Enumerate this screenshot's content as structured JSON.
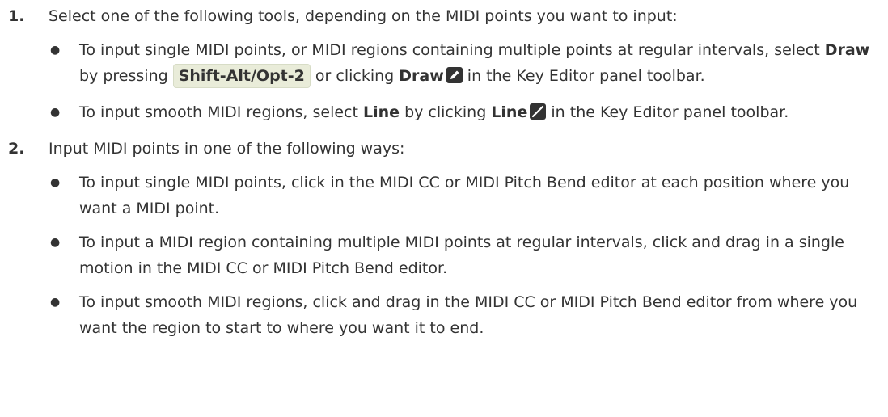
{
  "steps": [
    {
      "number": "1.",
      "text": "Select one of the following tools, depending on the MIDI points you want to input:",
      "bullets": {
        "draw": {
          "pre": "To input single MIDI points, or MIDI regions containing multiple points at regular intervals, select ",
          "tool": "Draw",
          "mid1": " by pressing ",
          "shortcut": "Shift-Alt/Opt-2",
          "mid2": " or clicking ",
          "tool2": "Draw",
          "icon": "draw-tool-icon",
          "post": " in the Key Editor panel toolbar."
        },
        "line": {
          "pre": "To input smooth MIDI regions, select ",
          "tool": "Line",
          "mid": " by clicking ",
          "tool2": "Line",
          "icon": "line-tool-icon",
          "post": " in the Key Editor panel toolbar."
        }
      }
    },
    {
      "number": "2.",
      "text": "Input MIDI points in one of the following ways:",
      "bullets": [
        "To input single MIDI points, click in the MIDI CC or MIDI Pitch Bend editor at each position where you want a MIDI point.",
        "To input a MIDI region containing multiple MIDI points at regular intervals, click and drag in a single motion in the MIDI CC or MIDI Pitch Bend editor.",
        "To input smooth MIDI regions, click and drag in the MIDI CC or MIDI Pitch Bend editor from where you want the region to start to where you want it to end."
      ]
    }
  ],
  "bullet_glyph": "●",
  "colors": {
    "text": "#333333",
    "shortcut_bg": "#e9ecd9",
    "icon_bg": "#333333"
  }
}
